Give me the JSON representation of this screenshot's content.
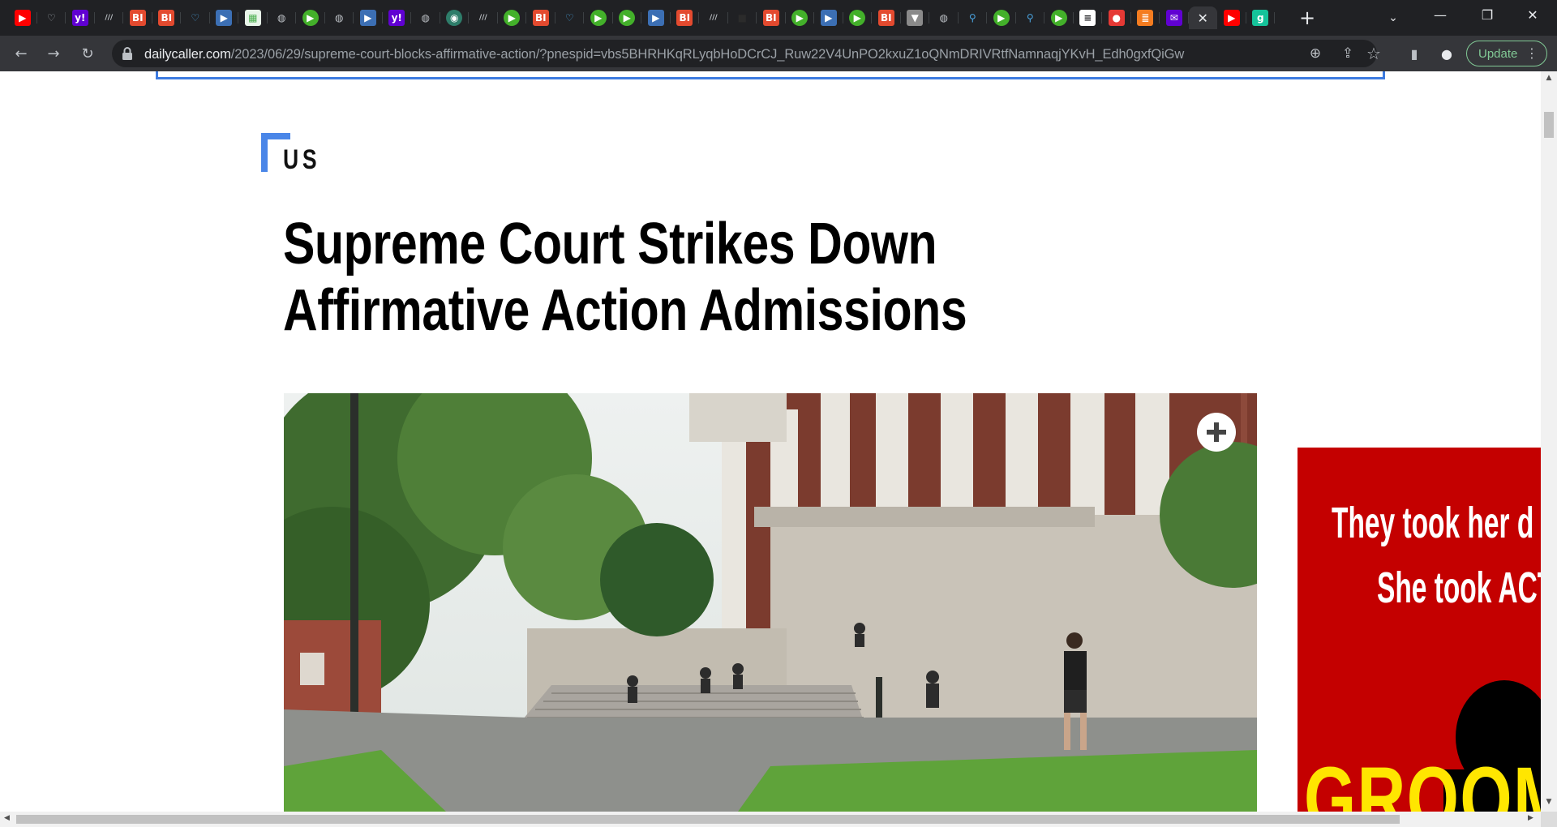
{
  "tabs": [
    {
      "icon": "youtube-icon",
      "glyph": "▶",
      "bg": "#ff0000",
      "fg": "#ffffff",
      "shape": "rounded"
    },
    {
      "icon": "heart-shield-icon",
      "glyph": "♡",
      "bg": "transparent",
      "fg": "#9aa0a6",
      "shape": "outline"
    },
    {
      "icon": "yahoo-icon",
      "glyph": "y!",
      "bg": "#6001d2",
      "fg": "#ffffff",
      "shape": "rounded"
    },
    {
      "icon": "stripes-icon",
      "glyph": "///",
      "bg": "transparent",
      "fg": "#bdc1c6",
      "shape": "outline"
    },
    {
      "icon": "business-insider-icon",
      "glyph": "BI",
      "bg": "#e34a2f",
      "fg": "#ffffff",
      "shape": "rounded"
    },
    {
      "icon": "business-insider-icon",
      "glyph": "BI",
      "bg": "#e34a2f",
      "fg": "#ffffff",
      "shape": "rounded"
    },
    {
      "icon": "heart-shield-icon",
      "glyph": "♡",
      "bg": "transparent",
      "fg": "#4aa3df",
      "shape": "outline"
    },
    {
      "icon": "bookmark-arrow-icon",
      "glyph": "▶",
      "bg": "#3c6fb4",
      "fg": "#ffffff",
      "shape": "rounded"
    },
    {
      "icon": "grid-icon",
      "glyph": "▦",
      "bg": "#e8f5e9",
      "fg": "#4caf50",
      "shape": "rounded"
    },
    {
      "icon": "globe-icon",
      "glyph": "◍",
      "bg": "transparent",
      "fg": "#bdc1c6",
      "shape": "outline"
    },
    {
      "icon": "play-circle-icon",
      "glyph": "▶",
      "bg": "#43b02a",
      "fg": "#ffffff",
      "shape": "circle"
    },
    {
      "icon": "globe-icon",
      "glyph": "◍",
      "bg": "transparent",
      "fg": "#bdc1c6",
      "shape": "outline"
    },
    {
      "icon": "bookmark-arrow-icon",
      "glyph": "▶",
      "bg": "#3c6fb4",
      "fg": "#ffffff",
      "shape": "rounded"
    },
    {
      "icon": "yahoo-icon",
      "glyph": "y!",
      "bg": "#6001d2",
      "fg": "#ffffff",
      "shape": "rounded"
    },
    {
      "icon": "globe-icon",
      "glyph": "◍",
      "bg": "transparent",
      "fg": "#bdc1c6",
      "shape": "outline"
    },
    {
      "icon": "tree-globe-icon",
      "glyph": "◉",
      "bg": "#2e7d6a",
      "fg": "#ffffff",
      "shape": "circle"
    },
    {
      "icon": "stripes-icon",
      "glyph": "///",
      "bg": "transparent",
      "fg": "#bdc1c6",
      "shape": "outline"
    },
    {
      "icon": "play-circle-icon",
      "glyph": "▶",
      "bg": "#43b02a",
      "fg": "#ffffff",
      "shape": "circle"
    },
    {
      "icon": "business-insider-icon",
      "glyph": "BI",
      "bg": "#e34a2f",
      "fg": "#ffffff",
      "shape": "rounded"
    },
    {
      "icon": "heart-shield-icon",
      "glyph": "♡",
      "bg": "transparent",
      "fg": "#4aa3df",
      "shape": "outline"
    },
    {
      "icon": "play-circle-icon",
      "glyph": "▶",
      "bg": "#43b02a",
      "fg": "#ffffff",
      "shape": "circle"
    },
    {
      "icon": "play-circle-icon",
      "glyph": "▶",
      "bg": "#43b02a",
      "fg": "#ffffff",
      "shape": "circle"
    },
    {
      "icon": "bookmark-arrow-icon",
      "glyph": "▶",
      "bg": "#3c6fb4",
      "fg": "#ffffff",
      "shape": "rounded"
    },
    {
      "icon": "business-insider-icon",
      "glyph": "BI",
      "bg": "#e34a2f",
      "fg": "#ffffff",
      "shape": "rounded"
    },
    {
      "icon": "stripes-icon",
      "glyph": "///",
      "bg": "transparent",
      "fg": "#bdc1c6",
      "shape": "outline"
    },
    {
      "icon": "dark-square-icon",
      "glyph": "■",
      "bg": "transparent",
      "fg": "#2b2b2b",
      "shape": "outline"
    },
    {
      "icon": "business-insider-icon",
      "glyph": "BI",
      "bg": "#e34a2f",
      "fg": "#ffffff",
      "shape": "rounded"
    },
    {
      "icon": "play-circle-icon",
      "glyph": "▶",
      "bg": "#43b02a",
      "fg": "#ffffff",
      "shape": "circle"
    },
    {
      "icon": "bookmark-arrow-icon",
      "glyph": "▶",
      "bg": "#3c6fb4",
      "fg": "#ffffff",
      "shape": "rounded"
    },
    {
      "icon": "play-circle-icon",
      "glyph": "▶",
      "bg": "#43b02a",
      "fg": "#ffffff",
      "shape": "circle"
    },
    {
      "icon": "business-insider-icon",
      "glyph": "BI",
      "bg": "#e34a2f",
      "fg": "#ffffff",
      "shape": "rounded"
    },
    {
      "icon": "podcast-icon",
      "glyph": "▼",
      "bg": "#8a8a8a",
      "fg": "#ffffff",
      "shape": "rounded"
    },
    {
      "icon": "globe-icon",
      "glyph": "◍",
      "bg": "transparent",
      "fg": "#bdc1c6",
      "shape": "outline"
    },
    {
      "icon": "search-icon",
      "glyph": "⚲",
      "bg": "transparent",
      "fg": "#4aa3df",
      "shape": "outline"
    },
    {
      "icon": "play-circle-icon",
      "glyph": "▶",
      "bg": "#43b02a",
      "fg": "#ffffff",
      "shape": "circle"
    },
    {
      "icon": "search-icon",
      "glyph": "⚲",
      "bg": "transparent",
      "fg": "#4aa3df",
      "shape": "outline"
    },
    {
      "icon": "play-circle-icon",
      "glyph": "▶",
      "bg": "#43b02a",
      "fg": "#ffffff",
      "shape": "circle"
    },
    {
      "icon": "news-icon",
      "glyph": "≡",
      "bg": "#ffffff",
      "fg": "#202124",
      "shape": "rounded"
    },
    {
      "icon": "microphone-icon",
      "glyph": "●",
      "bg": "#e53935",
      "fg": "#ffffff",
      "shape": "rounded"
    },
    {
      "icon": "bookmark-icon",
      "glyph": "≣",
      "bg": "#f47c20",
      "fg": "#ffffff",
      "shape": "rounded"
    },
    {
      "icon": "mail-icon",
      "glyph": "✉",
      "bg": "#6001d2",
      "fg": "#ffffff",
      "shape": "rounded"
    },
    {
      "icon": "close-icon",
      "glyph": "✕",
      "bg": "",
      "fg": "#e8eaed",
      "shape": "active"
    },
    {
      "icon": "youtube-icon",
      "glyph": "▶",
      "bg": "#ff0000",
      "fg": "#ffffff",
      "shape": "rounded"
    },
    {
      "icon": "g-icon",
      "glyph": "g",
      "bg": "#15c39a",
      "fg": "#ffffff",
      "shape": "rounded"
    }
  ],
  "window": {
    "new_tab_glyph": "+",
    "tab_search_glyph": "⌄",
    "minimize_glyph": "—",
    "restore_glyph": "❐",
    "close_glyph": "✕"
  },
  "toolbar": {
    "back_glyph": "←",
    "forward_glyph": "→",
    "reload_glyph": "↻",
    "url_host": "dailycaller.com",
    "url_path": "/2023/06/29/supreme-court-blocks-affirmative-action/?pnespid=vbs5BHRHKqRLyqbHoDCrCJ_Ruw22V4UnPO2kxuZ1oQNmDRIVRtfNamnaqjYKvH_Edh0gxfQiGw",
    "zoom_glyph": "⊕",
    "share_glyph": "⇪",
    "star_glyph": "☆",
    "sidepanel_glyph": "▮",
    "profile_glyph": "●",
    "update_label": "Update",
    "menu_glyph": "⋮"
  },
  "article": {
    "category": "US",
    "headline": "Supreme Court Strikes Down Affirmative Action Admissions",
    "expand_glyph": "+"
  },
  "ad": {
    "line1": "They took her d",
    "line2": "She took ACT",
    "line3": "GROOM"
  },
  "scroll": {
    "up_glyph": "▲",
    "down_glyph": "▼",
    "left_glyph": "◀",
    "right_glyph": "▶"
  },
  "colors": {
    "tabstrip": "#202124",
    "toolbar": "#35363a",
    "accent_blue": "#4a86e8",
    "ad_red": "#c40000",
    "ad_yellow": "#ffe600",
    "update_green": "#81c995"
  }
}
